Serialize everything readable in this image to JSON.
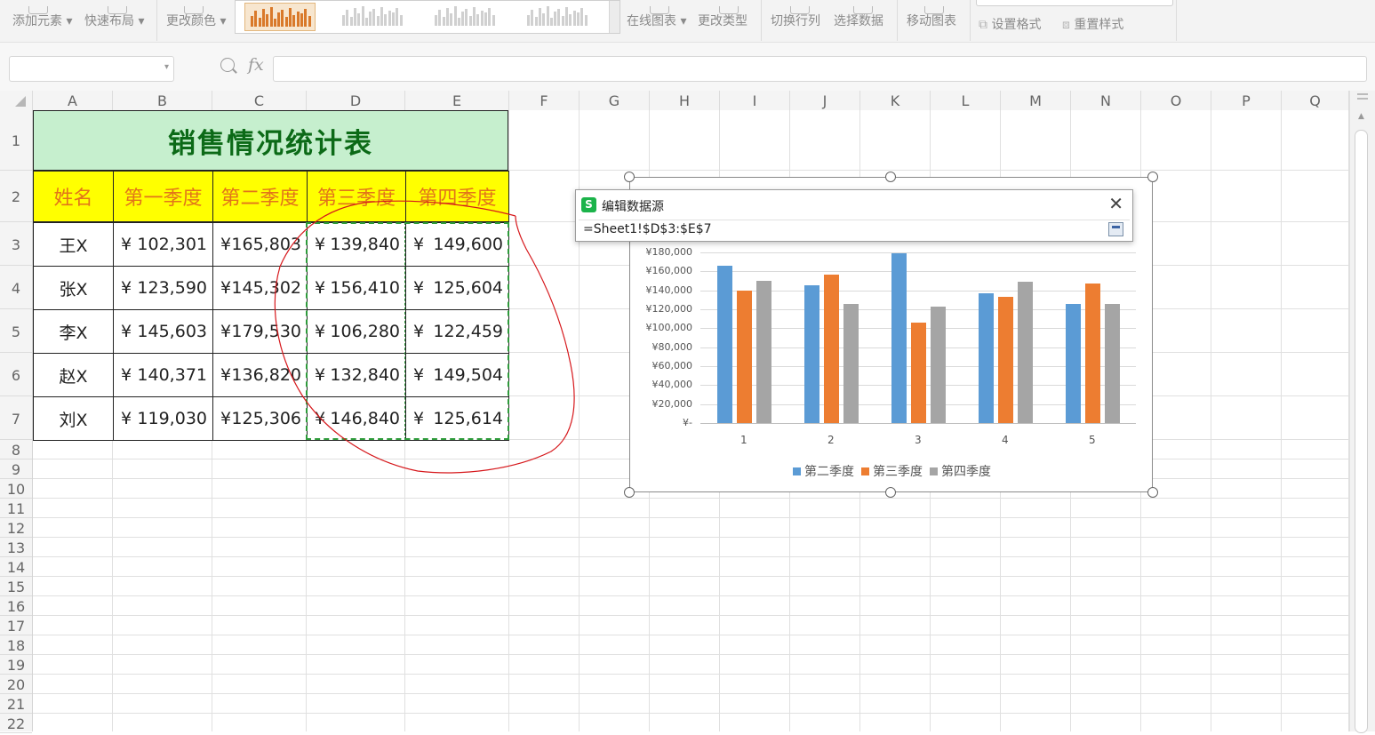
{
  "ribbon": {
    "add_element": "添加元素",
    "quick_layout": "快速布局",
    "change_color": "更改颜色",
    "online_chart": "在线图表",
    "change_type": "更改类型",
    "switch_row_col": "切换行列",
    "select_data": "选择数据",
    "move_chart": "移动图表",
    "set_format": "设置格式",
    "reset_style": "重置样式"
  },
  "formula_bar": {
    "name_box": "",
    "fx_label": "fx",
    "formula": ""
  },
  "columns": [
    "A",
    "B",
    "C",
    "D",
    "E",
    "F",
    "G",
    "H",
    "I",
    "J",
    "K",
    "L",
    "M",
    "N",
    "O",
    "P",
    "Q"
  ],
  "rows": [
    "1",
    "2",
    "3",
    "4",
    "5",
    "6",
    "7",
    "8",
    "9",
    "10",
    "11",
    "12",
    "13",
    "14",
    "15",
    "16",
    "17",
    "18",
    "19",
    "20",
    "21",
    "22"
  ],
  "table": {
    "title": "销售情况统计表",
    "headers": [
      "姓名",
      "第一季度",
      "第二季度",
      "第三季度",
      "第四季度"
    ],
    "currency": "¥",
    "data": [
      {
        "name": "王X",
        "q1": "102,301",
        "q2": "165,803",
        "q3": "139,840",
        "q4": "149,600"
      },
      {
        "name": "张X",
        "q1": "123,590",
        "q2": "145,302",
        "q3": "156,410",
        "q4": "125,604"
      },
      {
        "name": "李X",
        "q1": "145,603",
        "q2": "179,530",
        "q3": "106,280",
        "q4": "122,459"
      },
      {
        "name": "赵X",
        "q1": "140,371",
        "q2": "136,820",
        "q3": "132,840",
        "q4": "149,504"
      },
      {
        "name": "刘X",
        "q1": "119,030",
        "q2": "125,306",
        "q3": "146,840",
        "q4": "125,614"
      }
    ]
  },
  "dialog": {
    "title": "编辑数据源",
    "logo": "S",
    "close": "✕",
    "range": "=Sheet1!$D$3:$E$7"
  },
  "chart_data": {
    "type": "bar",
    "categories": [
      "1",
      "2",
      "3",
      "4",
      "5"
    ],
    "series": [
      {
        "name": "第二季度",
        "color": "#5b9bd5",
        "values": [
          165803,
          145302,
          179530,
          136820,
          125306
        ]
      },
      {
        "name": "第三季度",
        "color": "#ed7d31",
        "values": [
          139840,
          156410,
          106280,
          132840,
          146840
        ]
      },
      {
        "name": "第四季度",
        "color": "#a5a5a5",
        "values": [
          149600,
          125604,
          122459,
          149504,
          125614
        ]
      }
    ],
    "ylim": [
      0,
      180000
    ],
    "yticks": [
      "¥-",
      "¥20,000",
      "¥40,000",
      "¥60,000",
      "¥80,000",
      "¥100,000",
      "¥120,000",
      "¥140,000",
      "¥160,000",
      "¥180,000"
    ],
    "legend_position": "bottom",
    "grid": true
  }
}
